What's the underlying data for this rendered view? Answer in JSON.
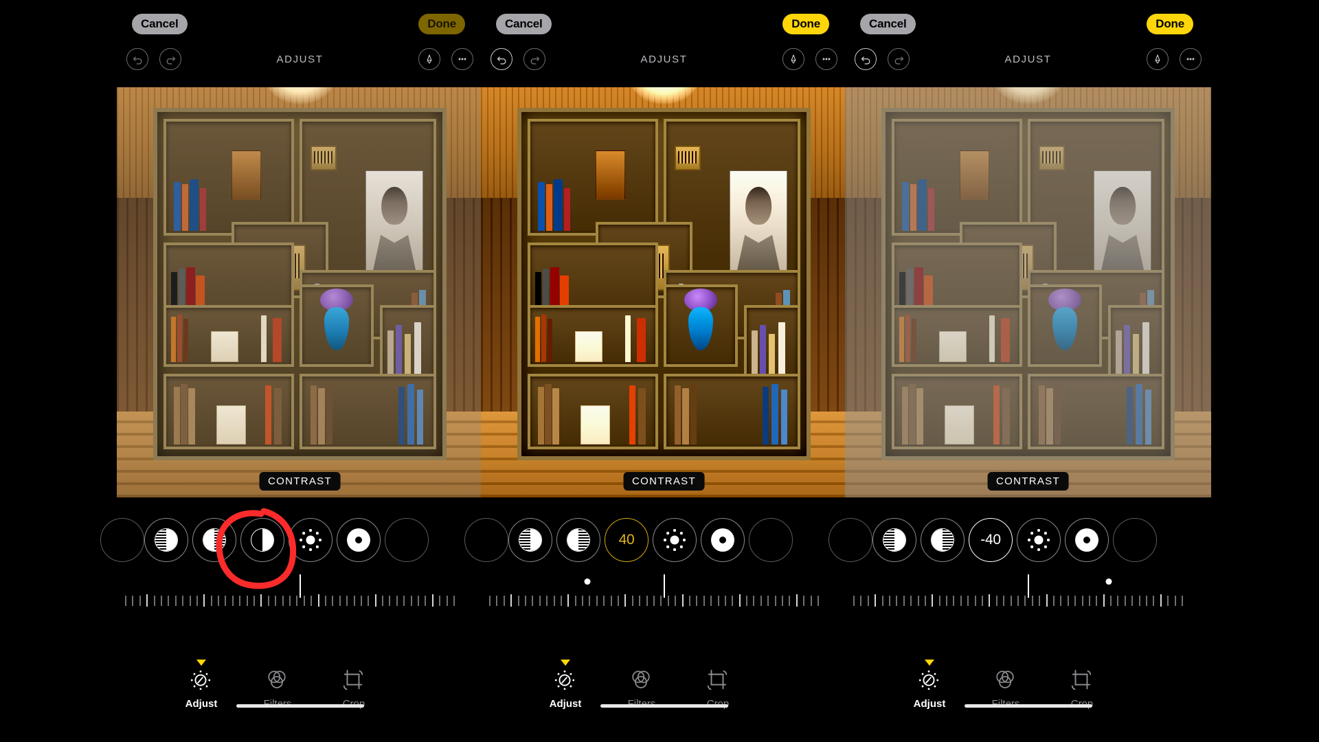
{
  "app": {
    "screen_title": "ADJUST",
    "tool_label": "CONTRAST"
  },
  "panels": [
    {
      "id": "panel-1",
      "cancel_label": "Cancel",
      "done_label": "Done",
      "done_state": "disabled",
      "title": "ADJUST",
      "undo_state": "disabled",
      "redo_state": "disabled",
      "tool_label": "CONTRAST",
      "selected_adjustment": "contrast",
      "contrast_value": "",
      "value_display": "",
      "slider_center_percent": 50,
      "slider_dot_percent": null,
      "annotation": "red-circle-on-contrast-icon"
    },
    {
      "id": "panel-2",
      "cancel_label": "Cancel",
      "done_label": "Done",
      "done_state": "enabled",
      "title": "ADJUST",
      "undo_state": "enabled",
      "redo_state": "disabled",
      "tool_label": "CONTRAST",
      "selected_adjustment": "contrast",
      "contrast_value": "40",
      "value_display": "40",
      "slider_center_percent": 50,
      "slider_dot_percent": 29,
      "annotation": null
    },
    {
      "id": "panel-3",
      "cancel_label": "Cancel",
      "done_label": "Done",
      "done_state": "enabled",
      "title": "ADJUST",
      "undo_state": "enabled",
      "redo_state": "disabled",
      "tool_label": "CONTRAST",
      "selected_adjustment": "contrast",
      "contrast_value": "-40",
      "value_display": "-40",
      "slider_center_percent": 50,
      "slider_dot_percent": 72,
      "annotation": null
    }
  ],
  "adjustment_icons": [
    {
      "name": "auto-enhance-icon",
      "glyph": "half-stripe-left"
    },
    {
      "name": "exposure-icon",
      "glyph": "half-stripe-right"
    },
    {
      "name": "contrast-icon",
      "glyph": "half-solid-right"
    },
    {
      "name": "brilliance-icon",
      "glyph": "sun"
    },
    {
      "name": "highlights-icon",
      "glyph": "donut"
    }
  ],
  "toolbar_icons": [
    {
      "name": "undo-icon",
      "label": "Undo"
    },
    {
      "name": "redo-icon",
      "label": "Redo"
    },
    {
      "name": "markup-icon",
      "label": "Markup"
    },
    {
      "name": "more-options-icon",
      "label": "More"
    }
  ],
  "bottom_tabs": [
    {
      "name": "tab-adjust",
      "label": "Adjust",
      "active": true
    },
    {
      "name": "tab-filters",
      "label": "Filters",
      "active": false
    },
    {
      "name": "tab-crop",
      "label": "Crop",
      "active": false
    }
  ],
  "colors": {
    "accent_yellow": "#ffd60a",
    "accent_yellow_dim": "#7d6600",
    "value_yellow": "#e3b418",
    "cancel_gray": "#a5a5aa",
    "annotation_red": "#fc2b2b",
    "background": "#000000",
    "inactive_text": "#8e8e93"
  }
}
